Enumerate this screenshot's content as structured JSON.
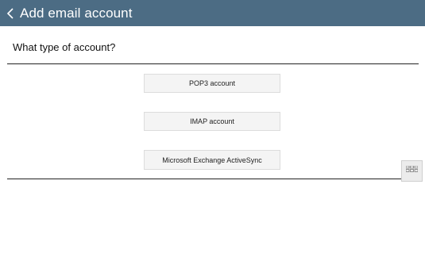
{
  "header": {
    "title": "Add email account",
    "back_icon": "chevron-left-icon",
    "background_color": "#4c6c84"
  },
  "main": {
    "question": "What type of account?",
    "options": [
      {
        "label": "POP3 account"
      },
      {
        "label": "IMAP account"
      },
      {
        "label": "Microsoft Exchange ActiveSync"
      }
    ]
  },
  "floating_button": {
    "icon": "grid-icon"
  }
}
